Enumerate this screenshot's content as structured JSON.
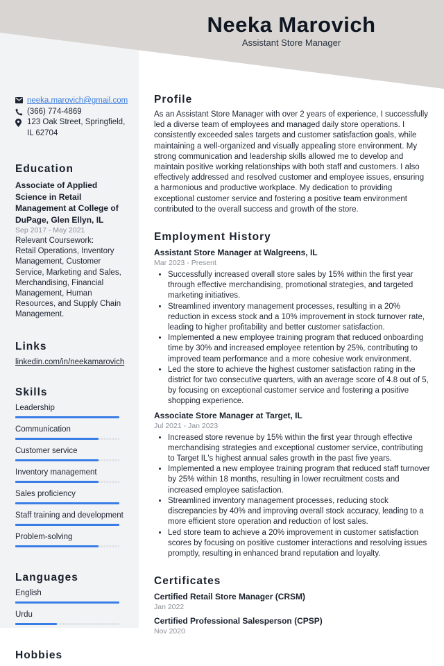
{
  "header": {
    "name": "Neeka Marovich",
    "title": "Assistant Store Manager"
  },
  "colors": {
    "header_bg": "#d8d5d2",
    "sidebar_bg": "#f2f3f5",
    "accent": "#3a7de6",
    "link": "#3b7ddd"
  },
  "contact": {
    "email": "neeka.marovich@gmail.com",
    "phone": "(366) 774-4869",
    "address": "123 Oak Street, Springfield, IL 62704",
    "icons": [
      "envelope-icon",
      "phone-icon",
      "map-pin-icon"
    ]
  },
  "education": {
    "title": "Education",
    "degree": "Associate of Applied Science in Retail Management at College of DuPage, Glen Ellyn, IL",
    "dates": "Sep 2017 - May 2021",
    "coursework_label": "Relevant Coursework:",
    "coursework": "Retail Operations, Inventory Management, Customer Service, Marketing and Sales, Merchandising, Financial Management, Human Resources, and Supply Chain Management."
  },
  "links": {
    "title": "Links",
    "items": [
      "linkedin.com/in/neekamarovich"
    ]
  },
  "skills": {
    "title": "Skills",
    "items": [
      {
        "label": "Leadership",
        "level": 1.0
      },
      {
        "label": "Communication",
        "level": 0.8
      },
      {
        "label": "Customer service",
        "level": 0.8
      },
      {
        "label": "Inventory management",
        "level": 0.8
      },
      {
        "label": "Sales proficiency",
        "level": 1.0
      },
      {
        "label": "Staff training and development",
        "level": 1.0
      },
      {
        "label": "Problem-solving",
        "level": 0.8
      }
    ]
  },
  "languages": {
    "title": "Languages",
    "items": [
      {
        "label": "English",
        "level": 1.0
      },
      {
        "label": "Urdu",
        "level": 0.4
      }
    ]
  },
  "hobbies": {
    "title": "Hobbies"
  },
  "profile": {
    "title": "Profile",
    "text": "As an Assistant Store Manager with over 2 years of experience, I successfully led a diverse team of employees and managed daily store operations. I consistently exceeded sales targets and customer satisfaction goals, while maintaining a well-organized and visually appealing store environment. My strong communication and leadership skills allowed me to develop and maintain positive working relationships with both staff and customers. I also effectively addressed and resolved customer and employee issues, ensuring a harmonious and productive workplace. My dedication to providing exceptional customer service and fostering a positive team environment contributed to the overall success and growth of the store."
  },
  "employment": {
    "title": "Employment History",
    "jobs": [
      {
        "heading": "Assistant Store Manager at Walgreens, IL",
        "dates": "Mar 2023 - Present",
        "bullets": [
          "Successfully increased overall store sales by 15% within the first year through effective merchandising, promotional strategies, and targeted marketing initiatives.",
          "Streamlined inventory management processes, resulting in a 20% reduction in excess stock and a 10% improvement in stock turnover rate, leading to higher profitability and better customer satisfaction.",
          "Implemented a new employee training program that reduced onboarding time by 30% and increased employee retention by 25%, contributing to improved team performance and a more cohesive work environment.",
          "Led the store to achieve the highest customer satisfaction rating in the district for two consecutive quarters, with an average score of 4.8 out of 5, by focusing on exceptional customer service and fostering a positive shopping experience."
        ]
      },
      {
        "heading": "Associate Store Manager at Target, IL",
        "dates": "Jul 2021 - Jan 2023",
        "bullets": [
          "Increased store revenue by 15% within the first year through effective merchandising strategies and exceptional customer service, contributing to Target IL's highest annual sales growth in the past five years.",
          "Implemented a new employee training program that reduced staff turnover by 25% within 18 months, resulting in lower recruitment costs and increased employee satisfaction.",
          "Streamlined inventory management processes, reducing stock discrepancies by 40% and improving overall stock accuracy, leading to a more efficient store operation and reduction of lost sales.",
          "Led store team to achieve a 20% improvement in customer satisfaction scores by focusing on positive customer interactions and resolving issues promptly, resulting in enhanced brand reputation and loyalty."
        ]
      }
    ]
  },
  "certificates": {
    "title": "Certificates",
    "items": [
      {
        "name": "Certified Retail Store Manager (CRSM)",
        "date": "Jan 2022"
      },
      {
        "name": "Certified Professional Salesperson (CPSP)",
        "date": "Nov 2020"
      }
    ]
  }
}
